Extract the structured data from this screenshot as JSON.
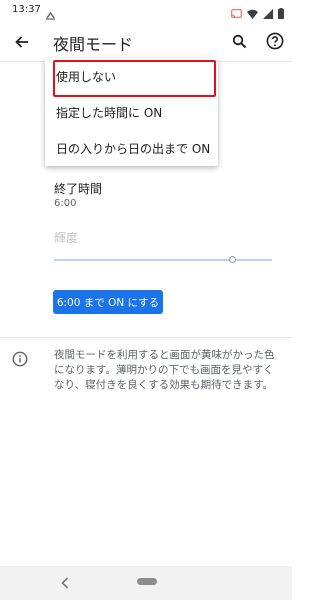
{
  "status_bar": {
    "time": "13:37",
    "left_icons": [
      "cloud-sync-icon"
    ],
    "right_icons": [
      "cast-icon",
      "wifi-icon",
      "signal-icon",
      "battery-icon"
    ]
  },
  "app_bar": {
    "title": "夜間モード",
    "icons": [
      "back-arrow-icon",
      "search-icon",
      "help-icon"
    ]
  },
  "dropdown": {
    "options": [
      "使用しない",
      "指定した時間に ON",
      "日の入りから日の出まで ON"
    ],
    "highlighted_index": 0
  },
  "settings": {
    "end_time_label": "終了時間",
    "end_time_value": "6:00",
    "brightness_label": "輝度",
    "brightness_level": 0.82
  },
  "action_button": "6:00 まで ON にする",
  "info": {
    "icon": "info-icon",
    "text": "夜間モードを利用すると画面が黄味がかった色になります。薄明かりの下でも画面を見やすくなり、寝付きを良くする効果も期待できます。"
  },
  "colors": {
    "accent": "#1a73e8",
    "highlight": "#e0121b"
  }
}
